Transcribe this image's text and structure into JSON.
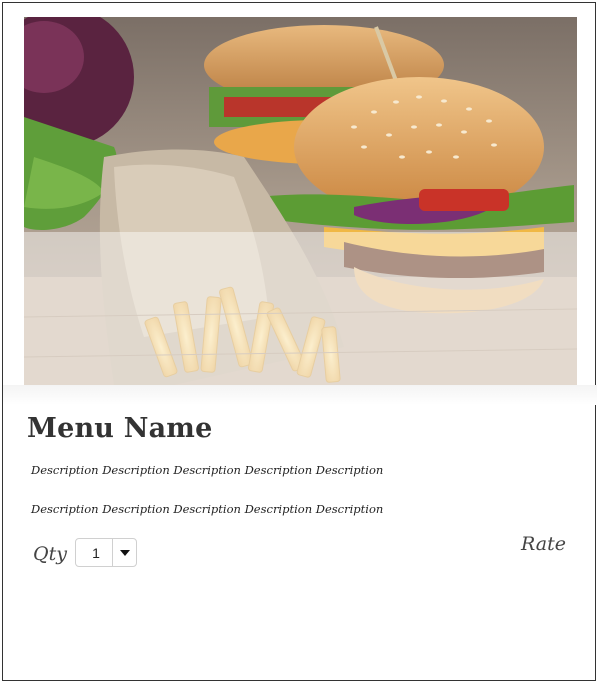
{
  "card": {
    "image_description_alt": "menu-item-photo",
    "menu_name": "Menu Name",
    "descriptions": [
      "Description Description Description Description Description",
      "Description Description Description Description Description"
    ],
    "qty_label": "Qty",
    "qty_value": "1",
    "rate_label": "Rate"
  },
  "icons": {
    "dropdown": "chevron-down-icon"
  },
  "colors": {
    "title": "#333333",
    "border": "#333333",
    "select_border": "#d0d0d0"
  }
}
